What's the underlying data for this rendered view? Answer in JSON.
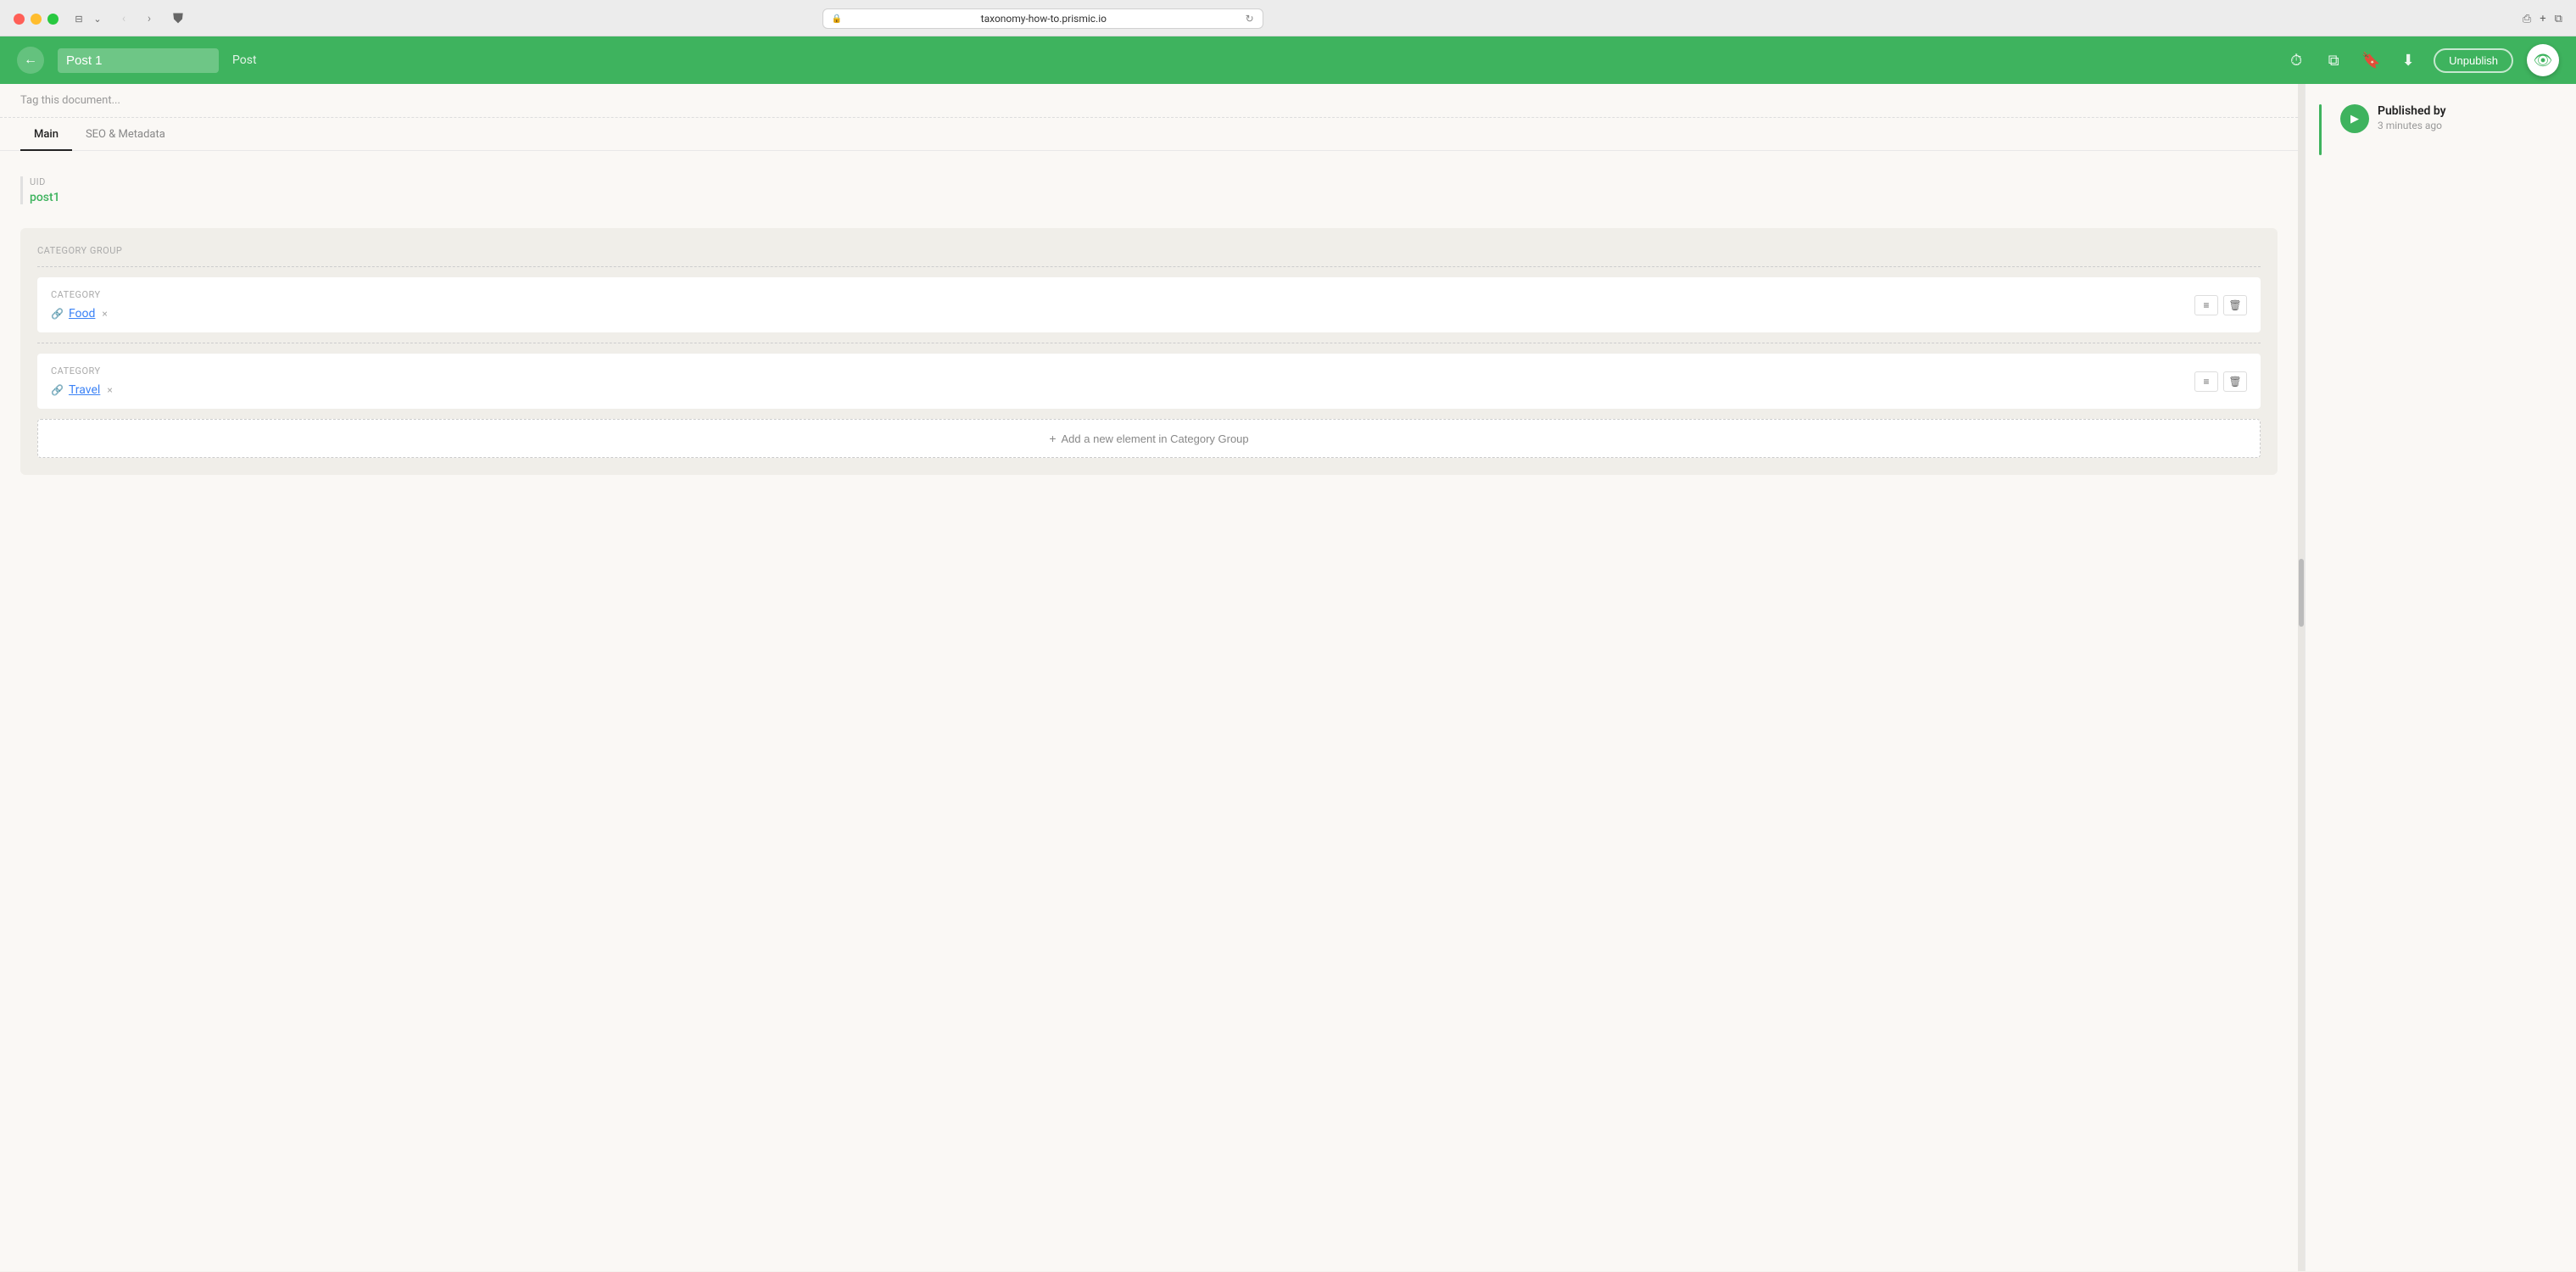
{
  "browser": {
    "url": "taxonomy-how-to.prismic.io",
    "tab_icon": "📄"
  },
  "header": {
    "doc_title": "Post 1",
    "doc_type": "Post",
    "back_label": "←",
    "unpublish_label": "Unpublish",
    "icons": {
      "history": "⏱",
      "copy": "⧉",
      "save": "⬆",
      "download": "⬇"
    }
  },
  "tag_bar": {
    "placeholder": "Tag this document..."
  },
  "tabs": [
    {
      "label": "Main",
      "active": true
    },
    {
      "label": "SEO & Metadata",
      "active": false
    }
  ],
  "uid_field": {
    "label": "UID",
    "value": "post1"
  },
  "category_group": {
    "label": "Category Group",
    "items": [
      {
        "field_label": "Category",
        "link_text": "Food",
        "has_link": true
      },
      {
        "field_label": "Category",
        "link_text": "Travel",
        "has_link": true
      }
    ],
    "add_button_label": "Add a new element in Category Group"
  },
  "sidebar": {
    "published_by_label": "Published by",
    "published_time": "3 minutes ago"
  }
}
